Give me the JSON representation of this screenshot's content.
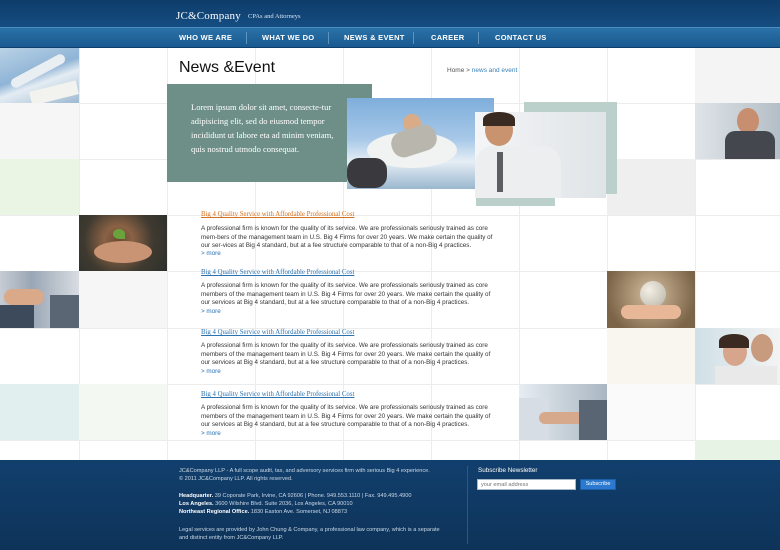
{
  "header": {
    "logo": "JC&Company",
    "tagline": "CPAs and Attorneys"
  },
  "nav": {
    "items": [
      {
        "label": "WHO WE ARE"
      },
      {
        "label": "WHAT WE DO"
      },
      {
        "label": "NEWS & EVENT"
      },
      {
        "label": "CAREER"
      },
      {
        "label": "CONTACT US"
      }
    ]
  },
  "page": {
    "title": "News &Event",
    "breadcrumb_home": "Home",
    "breadcrumb_sep": " > ",
    "breadcrumb_current": "news and event"
  },
  "hero": {
    "text": "Lorem ipsum dolor sit amet, consecte-tur adipisicing elit, sed do eiusmod tempor incididunt ut labore eta ad minim veniam, quis nostrud utmodo consequat."
  },
  "articles": [
    {
      "title": "Big 4 Quality Service with Affordable Professional Cost",
      "body": "A professional firm is known for the quality of its service. We are professionals seriously trained as core mem-bers of the management team in U.S. Big 4 Firms for over 20 years. We make certain the quality of our ser-vices at Big 4 standard, but at a fee structure comparable to that of a non-Big 4 practices.",
      "more": "> more"
    },
    {
      "title": "Big 4 Quality Service with Affordable Professional Cost",
      "body": "A professional firm is known for the quality of its service. We are professionals seriously trained as core members of the management team in U.S. Big 4 Firms for over 20 years. We make certain the quality of our services at Big 4 standard, but at a fee structure comparable to that of a non-Big 4 practices.",
      "more": "> more"
    },
    {
      "title": "Big 4 Quality Service with Affordable Professional Cost",
      "body": "A professional firm is known for the quality of its service. We are professionals seriously trained as core members of the management team in U.S. Big 4 Firms for over 20 years. We make certain the quality of our services at Big 4 standard, but at a fee structure comparable to that of a non-Big 4 practices.",
      "more": "> more"
    },
    {
      "title": "Big 4 Quality Service with Affordable Professional Cost",
      "body": "A professional firm is known for the quality of its service. We are professionals seriously trained as core members of the management team in U.S. Big 4 Firms for over 20 years. We make certain the quality of our services at Big 4 standard, but at a fee structure comparable to that of a non-Big 4 practices.",
      "more": "> more"
    }
  ],
  "footer": {
    "about": "JC&Company LLP - A full scope audit, tax, and adversory services firm with serious Big 4 experience.",
    "copyright": "© 2011 JC&Company LLP.  All rights reserved.",
    "hq_label": "Headquarter.",
    "hq_text": " 39 Coporate Park, Irvine, CA 92606  |  Phone. 949.553.1110  |  Fax. 949.495.4900",
    "la_label": "Los Angeles.",
    "la_text": " 3600 Wilshire Blvd. Suite 2036, Los Angeles, CA 90010",
    "ne_label": "Northeast Regional Office.",
    "ne_text": " 1830 Easton Ave. Somerset, NJ 08873",
    "legal": "Legal services are provided by John Chung & Company, a professional law company, which is a separate and distinct entity from JC&Company LLP.",
    "newsletter_label": "Subscribe Newsletter",
    "newsletter_placeholder": "your email address",
    "subscribe_label": "Subscribe"
  },
  "colors": {
    "header_dark": "#0e3c6a",
    "nav_blue": "#1a5a90",
    "hero_green": "#6e8f87",
    "link_blue": "#2a72b0",
    "link_orange": "#d5701c",
    "button_blue": "#2b7ad0"
  }
}
